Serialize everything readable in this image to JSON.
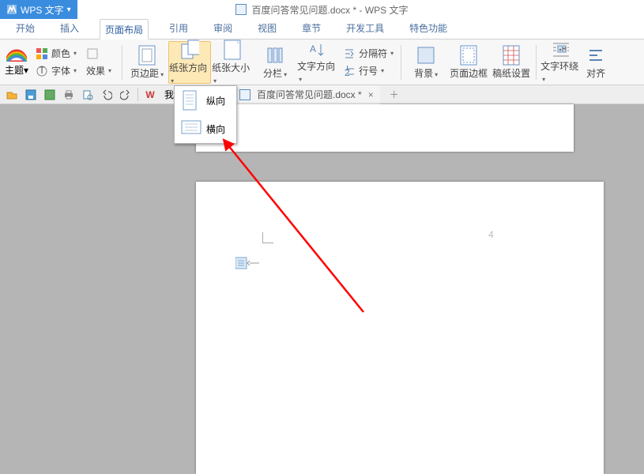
{
  "titlebar": {
    "app_name": "WPS 文字",
    "doc_title": "百度问答常见问题.docx * - WPS 文字"
  },
  "tabs": {
    "items": [
      {
        "label": "开始"
      },
      {
        "label": "插入"
      },
      {
        "label": "页面布局",
        "active": true
      },
      {
        "label": "引用"
      },
      {
        "label": "审阅"
      },
      {
        "label": "视图"
      },
      {
        "label": "章节"
      },
      {
        "label": "开发工具"
      },
      {
        "label": "特色功能"
      }
    ]
  },
  "ribbon": {
    "theme": "主题",
    "font": "字体",
    "effect": "效果",
    "color": "颜色",
    "margins": "页边距",
    "orientation": "纸张方向",
    "size": "纸张大小",
    "columns": "分栏",
    "textdir": "文字方向",
    "breaks": "分隔符",
    "linenum": "行号",
    "bg": "背景",
    "pageborder": "页面边框",
    "grid": "稿纸设置",
    "wrap": "文字环绕",
    "align": "对齐"
  },
  "qat": {
    "wps": "W",
    "my": "我"
  },
  "doctab": {
    "name": "百度问答常见问题.docx *"
  },
  "orientation_menu": {
    "portrait": "纵向",
    "landscape": "横向"
  },
  "canvas": {
    "page_number": "4"
  },
  "colors": {
    "accent": "#3a8cde",
    "ribbon_active": "#fde9b6",
    "arrow": "#ff0000"
  }
}
